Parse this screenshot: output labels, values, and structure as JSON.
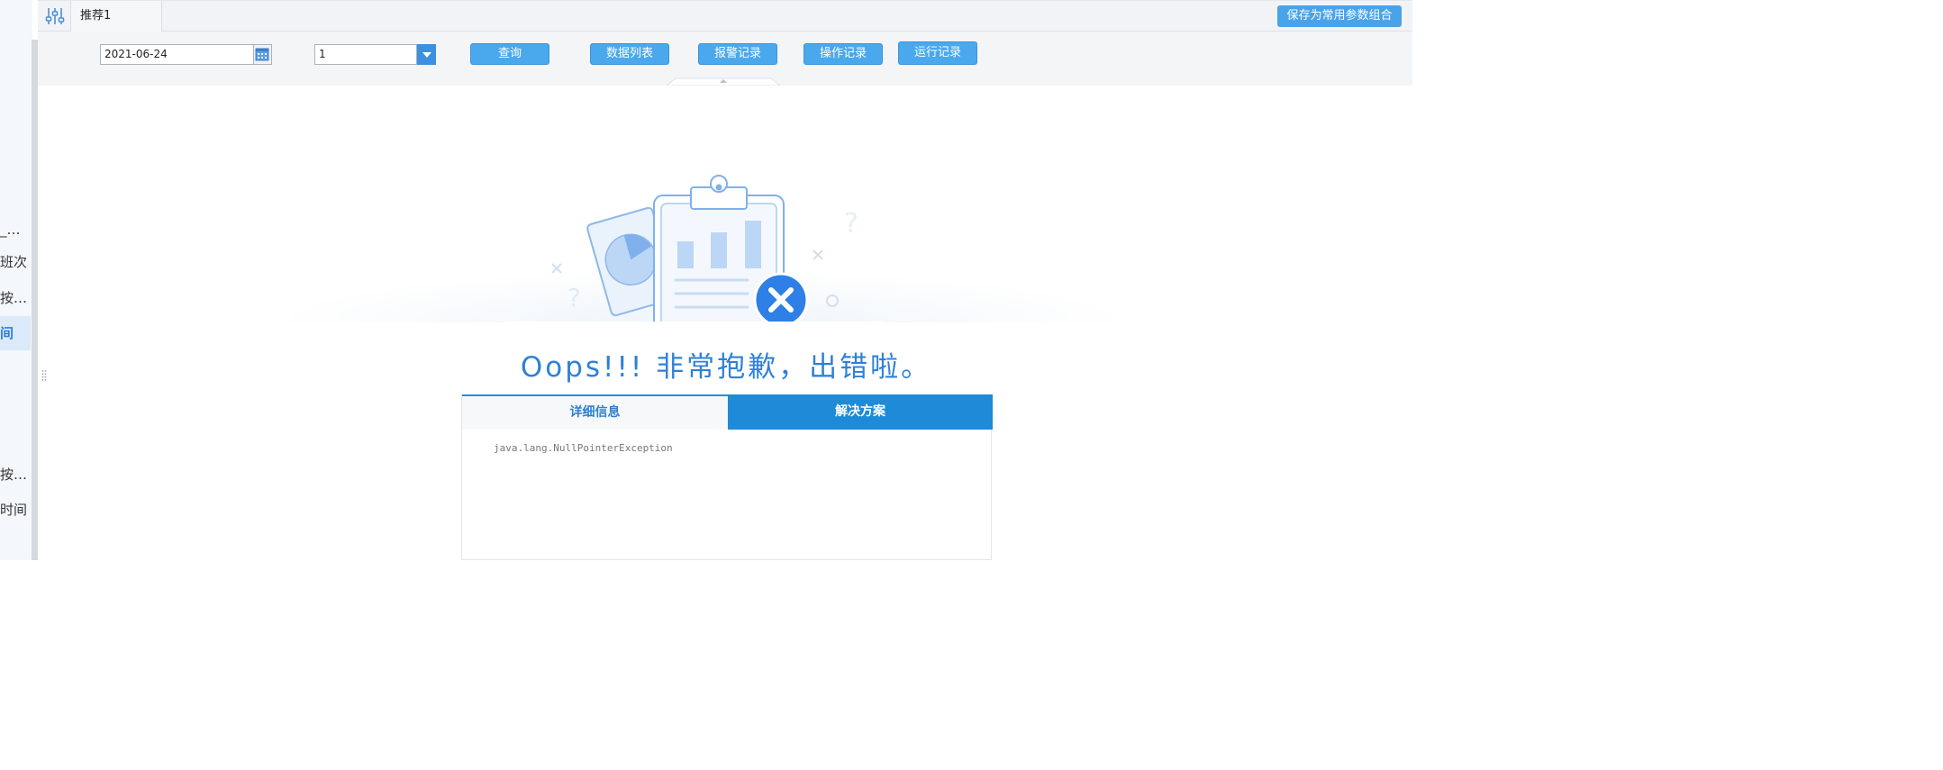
{
  "sidebar": {
    "items": [
      {
        "label": "_…",
        "active": false
      },
      {
        "label": "班次",
        "active": false
      },
      {
        "label": "按…",
        "active": false
      },
      {
        "label": "间",
        "active": true
      },
      {
        "label": "按…",
        "active": false
      },
      {
        "label": "时间",
        "active": false
      }
    ]
  },
  "header": {
    "tab_label": "推荐1",
    "save_label": "保存为常用参数组合"
  },
  "toolbar": {
    "date_value": "2021-06-24",
    "select_value": "1",
    "query_label": "查询",
    "data_list_label": "数据列表",
    "alarm_label": "报警记录",
    "operation_label": "操作记录",
    "run_label": "运行记录"
  },
  "error": {
    "title": "Oops!!! 非常抱歉，出错啦。",
    "tab_detail": "详细信息",
    "tab_solution": "解决方案",
    "message": "java.lang.NullPointerException"
  },
  "colors": {
    "accent": "#2f80d9",
    "button": "#4aa8ec",
    "solution_tab": "#1e8ad8",
    "error_badge": "#2e7fe6"
  }
}
